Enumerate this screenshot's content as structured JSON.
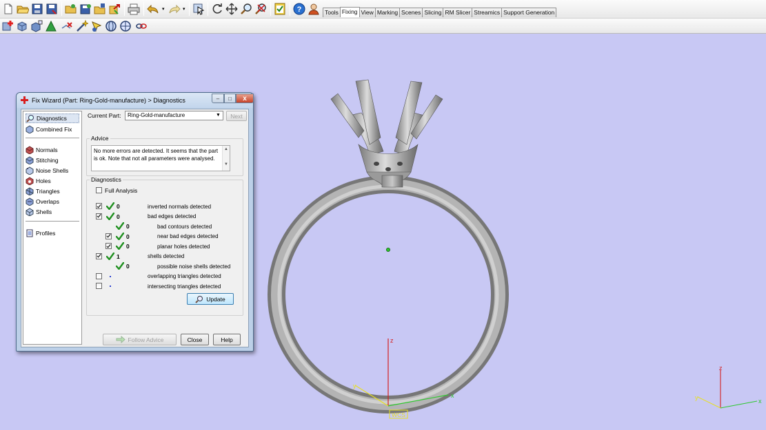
{
  "tabs": [
    {
      "label": "Tools",
      "active": false
    },
    {
      "label": "Fixing",
      "active": true
    },
    {
      "label": "View",
      "active": false
    },
    {
      "label": "Marking",
      "active": false
    },
    {
      "label": "Scenes",
      "active": false
    },
    {
      "label": "Slicing",
      "active": false
    },
    {
      "label": "RM Slicer",
      "active": false
    },
    {
      "label": "Streamics",
      "active": false
    },
    {
      "label": "Support Generation",
      "active": false
    }
  ],
  "toolbar1_icons": [
    "new-file-icon",
    "open-folder-icon",
    "save-icon",
    "save-as-icon",
    "load-part-icon",
    "save-part-icon",
    "open-project-icon",
    "export-icon",
    "print-icon",
    "undo-icon",
    "redo-icon",
    "select-icon",
    "rotate-icon",
    "pan-icon",
    "zoom-icon",
    "zoom-fit-icon",
    "checklist-icon",
    "help-icon",
    "advisor-icon"
  ],
  "toolbar2_icons": [
    "fix-wizard-icon",
    "part-box-icon",
    "part-select-icon",
    "triangle-icon",
    "remove-icon",
    "wand-icon",
    "pick-icon",
    "sphere-icon",
    "globe-icon",
    "link-icon"
  ],
  "viewport": {
    "wcs_label": "WCS",
    "axis_z": "z",
    "axis_x": "x",
    "axis_y": "y",
    "corner_z": "z",
    "corner_x": "x",
    "corner_y": "y",
    "background": "#c8c8f4"
  },
  "dialog": {
    "title": "Fix Wizard (Part: Ring-Gold-manufacture) > Diagnostics",
    "minimize": "–",
    "maximize": "□",
    "close": "x",
    "nav_items": [
      {
        "label": "Diagnostics",
        "icon": "diagnostics-icon",
        "selected": true
      },
      {
        "label": "Combined Fix",
        "icon": "combined-fix-icon",
        "selected": false
      },
      {
        "label": "Normals",
        "icon": "normals-icon",
        "selected": false
      },
      {
        "label": "Stitching",
        "icon": "stitching-icon",
        "selected": false
      },
      {
        "label": "Noise Shells",
        "icon": "noise-shells-icon",
        "selected": false
      },
      {
        "label": "Holes",
        "icon": "holes-icon",
        "selected": false
      },
      {
        "label": "Triangles",
        "icon": "triangles-icon",
        "selected": false
      },
      {
        "label": "Overlaps",
        "icon": "overlaps-icon",
        "selected": false
      },
      {
        "label": "Shells",
        "icon": "shells-icon",
        "selected": false
      },
      {
        "label": "Profiles",
        "icon": "profiles-icon",
        "selected": false
      }
    ],
    "current_part_label": "Current Part:",
    "current_part_value": "Ring-Gold-manufacture",
    "next_button": "Next",
    "advice_title": "Advice",
    "advice_text": "No more errors are detected. It seems that the part is ok. Note that not all parameters were analysed.",
    "diagnostics_title": "Diagnostics",
    "full_analysis_label": "Full Analysis",
    "full_analysis_checked": false,
    "rows": [
      {
        "label": "inverted normals detected",
        "count": "0",
        "checked": true,
        "level": 0,
        "status": "ok"
      },
      {
        "label": "bad edges detected",
        "count": "0",
        "checked": true,
        "level": 0,
        "status": "ok"
      },
      {
        "label": "bad contours detected",
        "count": "0",
        "checked": null,
        "level": 1,
        "status": "ok"
      },
      {
        "label": "near bad edges detected",
        "count": "0",
        "checked": true,
        "level": 1,
        "status": "ok"
      },
      {
        "label": "planar holes detected",
        "count": "0",
        "checked": true,
        "level": 1,
        "status": "ok"
      },
      {
        "label": "shells detected",
        "count": "1",
        "checked": true,
        "level": 0,
        "status": "ok"
      },
      {
        "label": "possible noise shells detected",
        "count": "0",
        "checked": null,
        "level": 1,
        "status": "ok"
      },
      {
        "label": "overlapping triangles detected",
        "count": "",
        "checked": false,
        "level": 0,
        "status": "none"
      },
      {
        "label": "intersecting triangles detected",
        "count": "",
        "checked": false,
        "level": 0,
        "status": "none"
      }
    ],
    "update_button": "Update",
    "follow_advice_button": "Follow Advice",
    "close_button": "Close",
    "help_button": "Help"
  },
  "colors": {
    "check_green": "#1f8f1f",
    "axis_red": "#d42020",
    "axis_green": "#2ec82e",
    "axis_yellow": "#e8e020"
  }
}
